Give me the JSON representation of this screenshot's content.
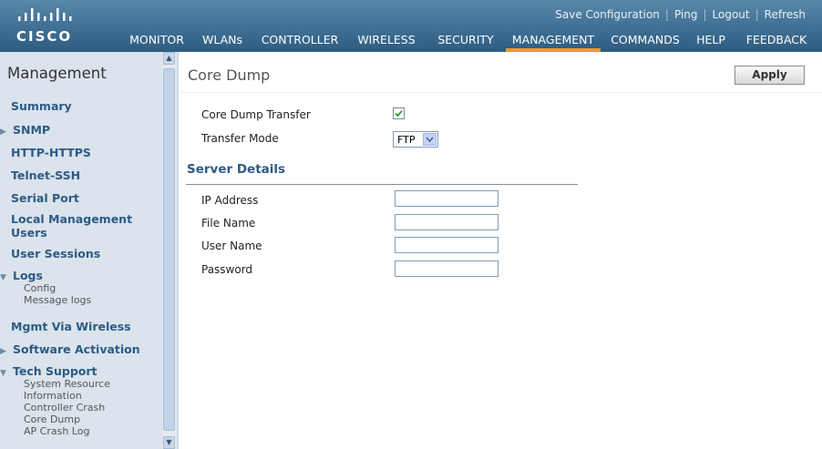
{
  "brand": {
    "name": "CISCO"
  },
  "top_links": [
    "Save Configuration",
    "Ping",
    "Logout",
    "Refresh"
  ],
  "menu": [
    "MONITOR",
    "WLANs",
    "CONTROLLER",
    "WIRELESS",
    "SECURITY",
    "MANAGEMENT",
    "COMMANDS",
    "HELP",
    "FEEDBACK"
  ],
  "active_menu": "MANAGEMENT",
  "accent_color": "#f39a23",
  "sidebar": {
    "title": "Management",
    "items": [
      {
        "label": "Summary"
      },
      {
        "label": "SNMP",
        "arrow": "▶"
      },
      {
        "label": "HTTP-HTTPS"
      },
      {
        "label": "Telnet-SSH"
      },
      {
        "label": "Serial Port"
      },
      {
        "label": "Local Management Users"
      },
      {
        "label": "User Sessions"
      },
      {
        "label": "Logs",
        "arrow": "▼",
        "children": [
          "Config",
          "Message logs"
        ]
      },
      {
        "label": "Mgmt Via Wireless"
      },
      {
        "label": "Software Activation",
        "arrow": "▶"
      },
      {
        "label": "Tech Support",
        "arrow": "▼",
        "children": [
          "System Resource Information",
          "Controller Crash",
          "Core Dump",
          "AP Crash Log"
        ]
      }
    ]
  },
  "page": {
    "title": "Core Dump",
    "apply_label": "Apply",
    "core_dump_transfer_label": "Core Dump Transfer",
    "core_dump_transfer_checked": true,
    "transfer_mode_label": "Transfer Mode",
    "transfer_mode_value": "FTP",
    "server_details_title": "Server Details",
    "ip_address_label": "IP Address",
    "ip_address_value": "",
    "file_name_label": "File Name",
    "file_name_value": "",
    "user_name_label": "User Name",
    "user_name_value": "",
    "password_label": "Password",
    "password_value": ""
  }
}
